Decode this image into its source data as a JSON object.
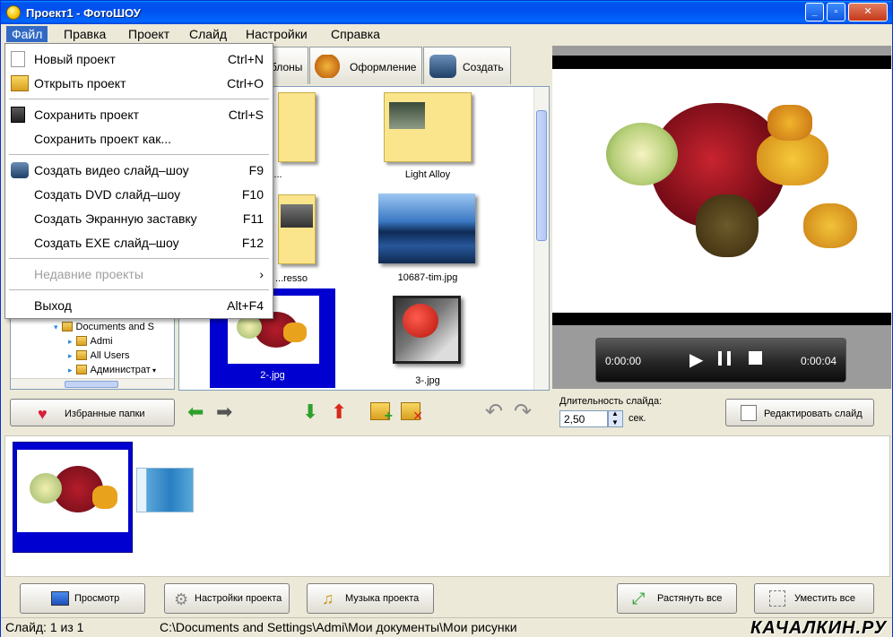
{
  "window": {
    "title": "Проект1 - ФотоШОУ"
  },
  "menubar": [
    "Файл",
    "Правка",
    "Проект",
    "Слайд",
    "Настройки",
    "Справка"
  ],
  "file_menu": {
    "items": [
      {
        "label": "Новый проект",
        "shortcut": "Ctrl+N",
        "icon": "new-doc-icon"
      },
      {
        "label": "Открыть проект",
        "shortcut": "Ctrl+O",
        "icon": "open-folder-icon"
      },
      {
        "label": "Сохранить проект",
        "shortcut": "Ctrl+S",
        "icon": "save-disk-icon"
      },
      {
        "label": "Сохранить проект как...",
        "shortcut": ""
      },
      {
        "label": "Создать видео слайд–шоу",
        "shortcut": "F9",
        "icon": "video-camera-icon"
      },
      {
        "label": "Создать DVD слайд–шоу",
        "shortcut": "F10"
      },
      {
        "label": "Создать Экранную заставку",
        "shortcut": "F11"
      },
      {
        "label": "Создать EXE слайд–шоу",
        "shortcut": "F12"
      },
      {
        "label": "Недавние проекты",
        "shortcut": "›"
      },
      {
        "label": "Выход",
        "shortcut": "Alt+F4"
      }
    ]
  },
  "tabs": [
    "...блоны",
    "Оформление",
    "Создать"
  ],
  "tree": {
    "items": [
      "Documents and S",
      "Admi",
      "All Users",
      "Администрат"
    ]
  },
  "thumbnails": {
    "captions": [
      "...",
      "Light Alloy",
      "...resso",
      "10687-tim.jpg",
      "2-.jpg",
      "3-.jpg"
    ]
  },
  "actions": {
    "fav_label": "Избранные папки"
  },
  "player": {
    "time_start": "0:00:00",
    "time_end": "0:00:04"
  },
  "duration": {
    "label": "Длительность слайда:",
    "value": "2,50",
    "unit": "сек."
  },
  "edit_slide_label": "Редактировать слайд",
  "bottom_buttons": [
    "Просмотр",
    "Настройки проекта",
    "Музыка проекта",
    "Растянуть все",
    "Уместить все"
  ],
  "status": {
    "slide": "Слайд: 1 из 1",
    "path": "C:\\Documents and Settings\\Admi\\Мои документы\\Мои рисунки",
    "watermark": "КАЧАЛКИН.РУ"
  },
  "colors": {
    "accent": "#316ac5",
    "titlebar": "#0054e3",
    "selection": "#0000d0"
  }
}
